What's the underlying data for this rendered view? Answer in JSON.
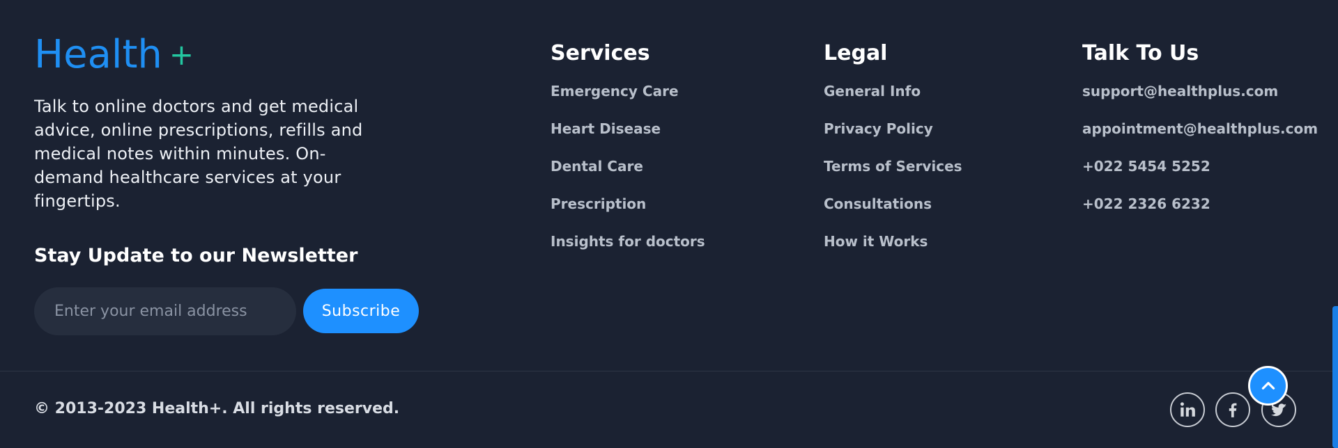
{
  "brand": {
    "name": "Health",
    "plus": "+"
  },
  "about": "Talk to online doctors and get medical advice, online prescriptions, refills and medical notes within minutes. On-demand healthcare services at your fingertips.",
  "newsletter": {
    "title": "Stay Update to our Newsletter",
    "placeholder": "Enter your email address",
    "value": "",
    "button": "Subscribe"
  },
  "services": {
    "title": "Services",
    "items": [
      "Emergency Care",
      "Heart Disease",
      "Dental Care",
      "Prescription",
      "Insights for doctors"
    ]
  },
  "legal": {
    "title": "Legal",
    "items": [
      "General Info",
      "Privacy Policy",
      "Terms of Services",
      "Consultations",
      "How it Works"
    ]
  },
  "contact": {
    "title": "Talk To Us",
    "items": [
      "support@healthplus.com",
      "appointment@healthplus.com",
      "+022 5454 5252",
      "+022 2326 6232"
    ]
  },
  "copyright": "© 2013-2023 Health+. All rights reserved.",
  "social": [
    "linkedin-icon",
    "facebook-icon",
    "twitter-icon"
  ],
  "colors": {
    "background": "#1b2232",
    "accent": "#1e90ff",
    "brand_plus": "#23c7a0"
  },
  "scroll_position": 0.85
}
